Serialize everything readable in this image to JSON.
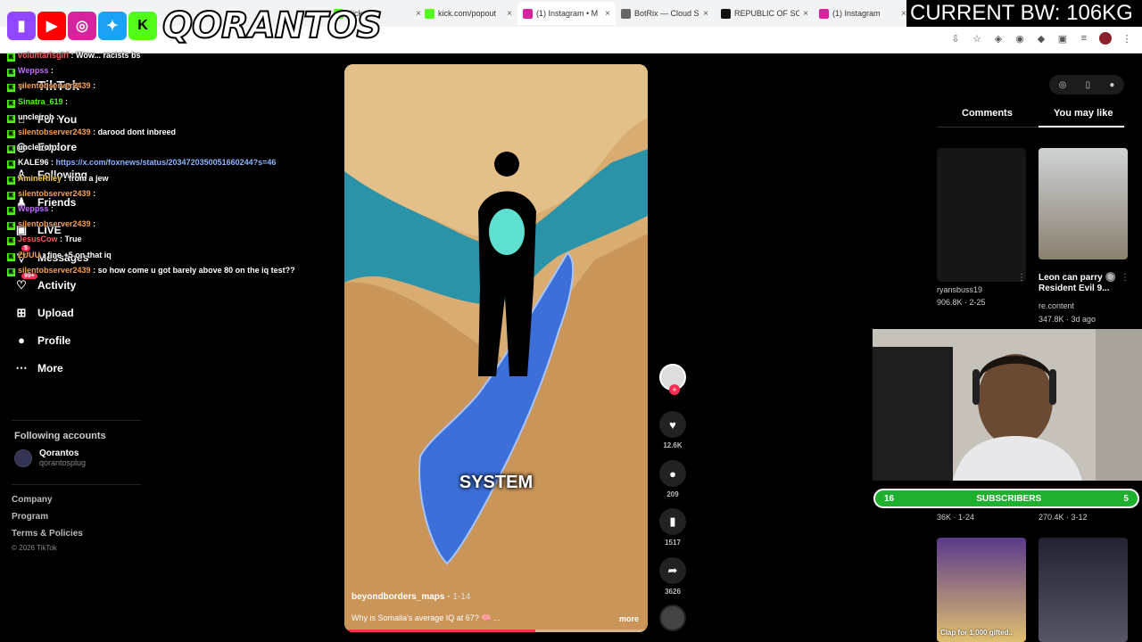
{
  "browser": {
    "tabs": [
      {
        "title": "Kick",
        "color": "#53fc18"
      },
      {
        "title": "kick.com/popout",
        "color": "#53fc18"
      },
      {
        "title": "(1) Instagram • M",
        "color": "#d6249f"
      },
      {
        "title": "BotRix — Cloud S",
        "color": "#666666"
      },
      {
        "title": "REPUBLIC OF SO",
        "color": "#111111"
      },
      {
        "title": "(1) Instagram",
        "color": "#d6249f"
      }
    ],
    "close_glyph": "×"
  },
  "overlay": {
    "streamer": "QORANTOS",
    "bandwidth": "CURRENT BW: 106KG",
    "platform_icons": [
      "twitch-icon",
      "youtube-icon",
      "instagram-icon",
      "twitter-icon",
      "kick-icon"
    ],
    "subscribers_label": "SUBSCRIBERS",
    "sub_left": "16",
    "sub_right": "5"
  },
  "sidebar": {
    "brand": "TikTok",
    "nav": [
      {
        "label": "For You",
        "icon": "home-icon"
      },
      {
        "label": "Explore",
        "icon": "compass-icon"
      },
      {
        "label": "Following",
        "icon": "following-icon"
      },
      {
        "label": "Friends",
        "icon": "friends-icon"
      },
      {
        "label": "LIVE",
        "icon": "live-icon"
      },
      {
        "label": "Messages",
        "icon": "messages-icon",
        "badge": "5"
      },
      {
        "label": "Activity",
        "icon": "activity-icon",
        "badge": "99+"
      },
      {
        "label": "Upload",
        "icon": "upload-icon"
      },
      {
        "label": "Profile",
        "icon": "profile-icon"
      },
      {
        "label": "More",
        "icon": "more-icon"
      }
    ],
    "following_accounts_title": "Following accounts",
    "account": {
      "name": "Qorantos",
      "handle": "qorantosplug"
    },
    "footer": [
      "Company",
      "Program",
      "Terms & Policies"
    ],
    "copyright": "© 2026 TikTok"
  },
  "chat": [
    {
      "user": "voluntarisgirl",
      "color": "#ff5b5b",
      "msg": "Wow... racists bs"
    },
    {
      "user": "Weppss",
      "color": "#c46bff",
      "msg": ""
    },
    {
      "user": "silentobserver2439",
      "color": "#f6a04d",
      "msg": ""
    },
    {
      "user": "Sinatra_619",
      "color": "#53fc18",
      "msg": ""
    },
    {
      "user": "uncleiroh",
      "color": "#ffffff",
      "msg": ""
    },
    {
      "user": "silentobserver2439",
      "color": "#f6a04d",
      "msg": "darood dont inbreed"
    },
    {
      "user": "uncleiroh",
      "color": "#ffffff",
      "msg": ""
    },
    {
      "user": "KALE96",
      "color": "#ffffff",
      "msg": "",
      "link": "https://x.com/foxnews/status/2034720350051660244?s=46"
    },
    {
      "user": "AmineRiley",
      "color": "#f6d04d",
      "msg": "from a jew"
    },
    {
      "user": "silentobserver2439",
      "color": "#f6a04d",
      "msg": ""
    },
    {
      "user": "Weppss",
      "color": "#c46bff",
      "msg": ""
    },
    {
      "user": "silentobserver2439",
      "color": "#f6a04d",
      "msg": ""
    },
    {
      "user": "JesusCow",
      "color": "#ff5b5b",
      "msg": "True"
    },
    {
      "user": "ZUUU",
      "color": "#f6a04d",
      "msg": "fine +5 on that iq"
    },
    {
      "user": "silentobserver2439",
      "color": "#f6a04d",
      "msg": "so how come u got barely above 80 on the iq test??"
    }
  ],
  "video": {
    "overlay_text": "SYSTEM",
    "author": "beyondborders_maps",
    "date": "1-14",
    "caption": "Why is Somalia's average IQ at 67? 🧠 ...",
    "more": "more",
    "progress": 0.63,
    "likes": "12.6K",
    "comments": "209",
    "saves": "1517",
    "shares": "3626"
  },
  "right_panel": {
    "tabs": [
      "Comments",
      "You may like"
    ],
    "active_tab": "You may like",
    "items": [
      {
        "title": "",
        "user": "ryansbuss19",
        "stats": "906.8K · 2-25"
      },
      {
        "title": "Leon can parry 🔘 Resident Evil 9...",
        "user": "re.content",
        "stats": "347.8K · 3d ago"
      },
      {
        "title": "",
        "user": "",
        "stats": "36K · 1-24"
      },
      {
        "title": "",
        "user": "",
        "stats": "270.4K · 3-12"
      },
      {
        "title": "",
        "user": "",
        "stats": "",
        "thumb_text": "Clap for 1,000 gifted.."
      },
      {
        "title": "",
        "user": "",
        "stats": ""
      }
    ]
  }
}
